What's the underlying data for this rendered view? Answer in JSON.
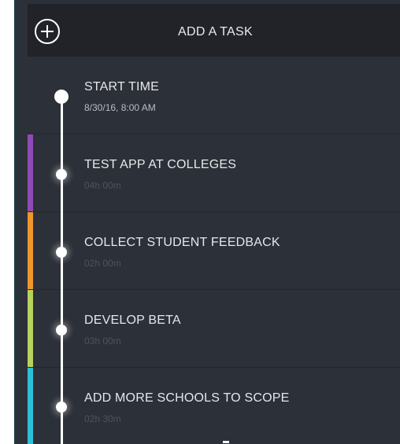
{
  "header": {
    "title": "ADD A TASK",
    "add_icon": "plus-circle-icon"
  },
  "start": {
    "label": "START TIME",
    "value": "8/30/16, 8:00 AM"
  },
  "tasks": [
    {
      "title": "TEST APP AT COLLEGES",
      "duration": "04h 00m",
      "color": "#8e4bb5"
    },
    {
      "title": "COLLECT STUDENT FEEDBACK",
      "duration": "02h 00m",
      "color": "#f0962c"
    },
    {
      "title": "DEVELOP BETA",
      "duration": "03h 00m",
      "color": "#b6d35d"
    },
    {
      "title": "ADD MORE SCHOOLS TO SCOPE",
      "duration": "02h 30m",
      "color": "#2cc0d6"
    }
  ],
  "colors": {
    "background": "#2c3038",
    "header": "#212328",
    "text": "#e6e7ea",
    "muted": "#4e535c"
  }
}
